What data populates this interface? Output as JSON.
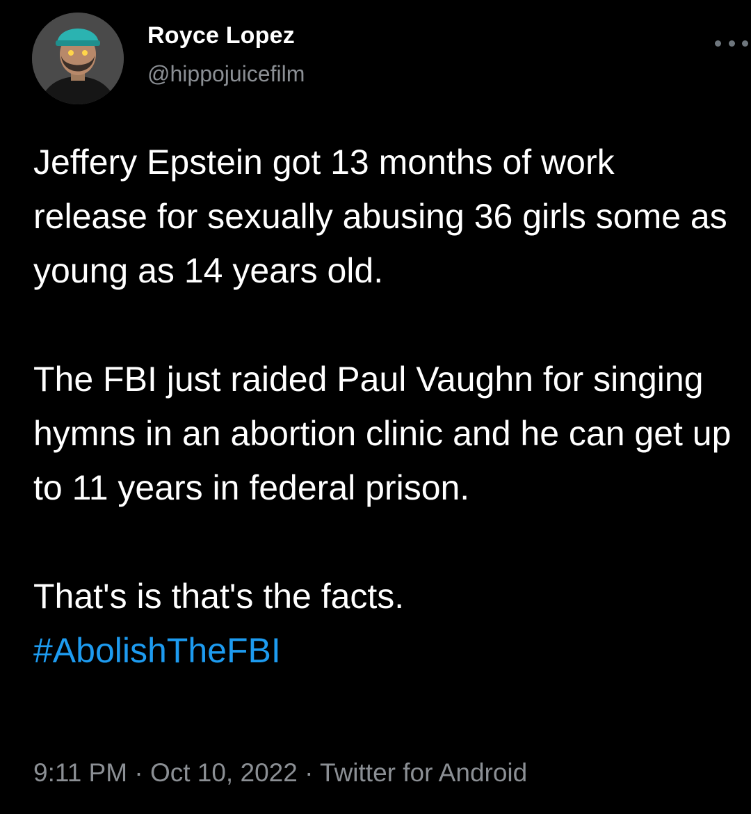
{
  "author": {
    "display_name": "Royce Lopez",
    "handle": "@hippojuicefilm",
    "avatar_icon": "user-avatar-photo"
  },
  "menu": {
    "icon": "more-options-icon"
  },
  "tweet": {
    "paragraph_1": "Jeffery Epstein got 13 months of work release for sexually abusing 36 girls some as young as 14 years old.",
    "paragraph_2": "The FBI just raided Paul Vaughn for singing hymns in an abortion clinic and he can get up to 11 years in federal prison.",
    "paragraph_3": "That's is that's the facts.",
    "hashtag": "#AbolishTheFBI"
  },
  "meta": {
    "time": "9:11 PM",
    "separator_1": " · ",
    "date": "Oct 10, 2022",
    "separator_2": " · ",
    "source": "Twitter for Android"
  },
  "colors": {
    "background": "#000000",
    "text": "#ffffff",
    "secondary_text": "#8b8f94",
    "link": "#1d9bf0"
  }
}
